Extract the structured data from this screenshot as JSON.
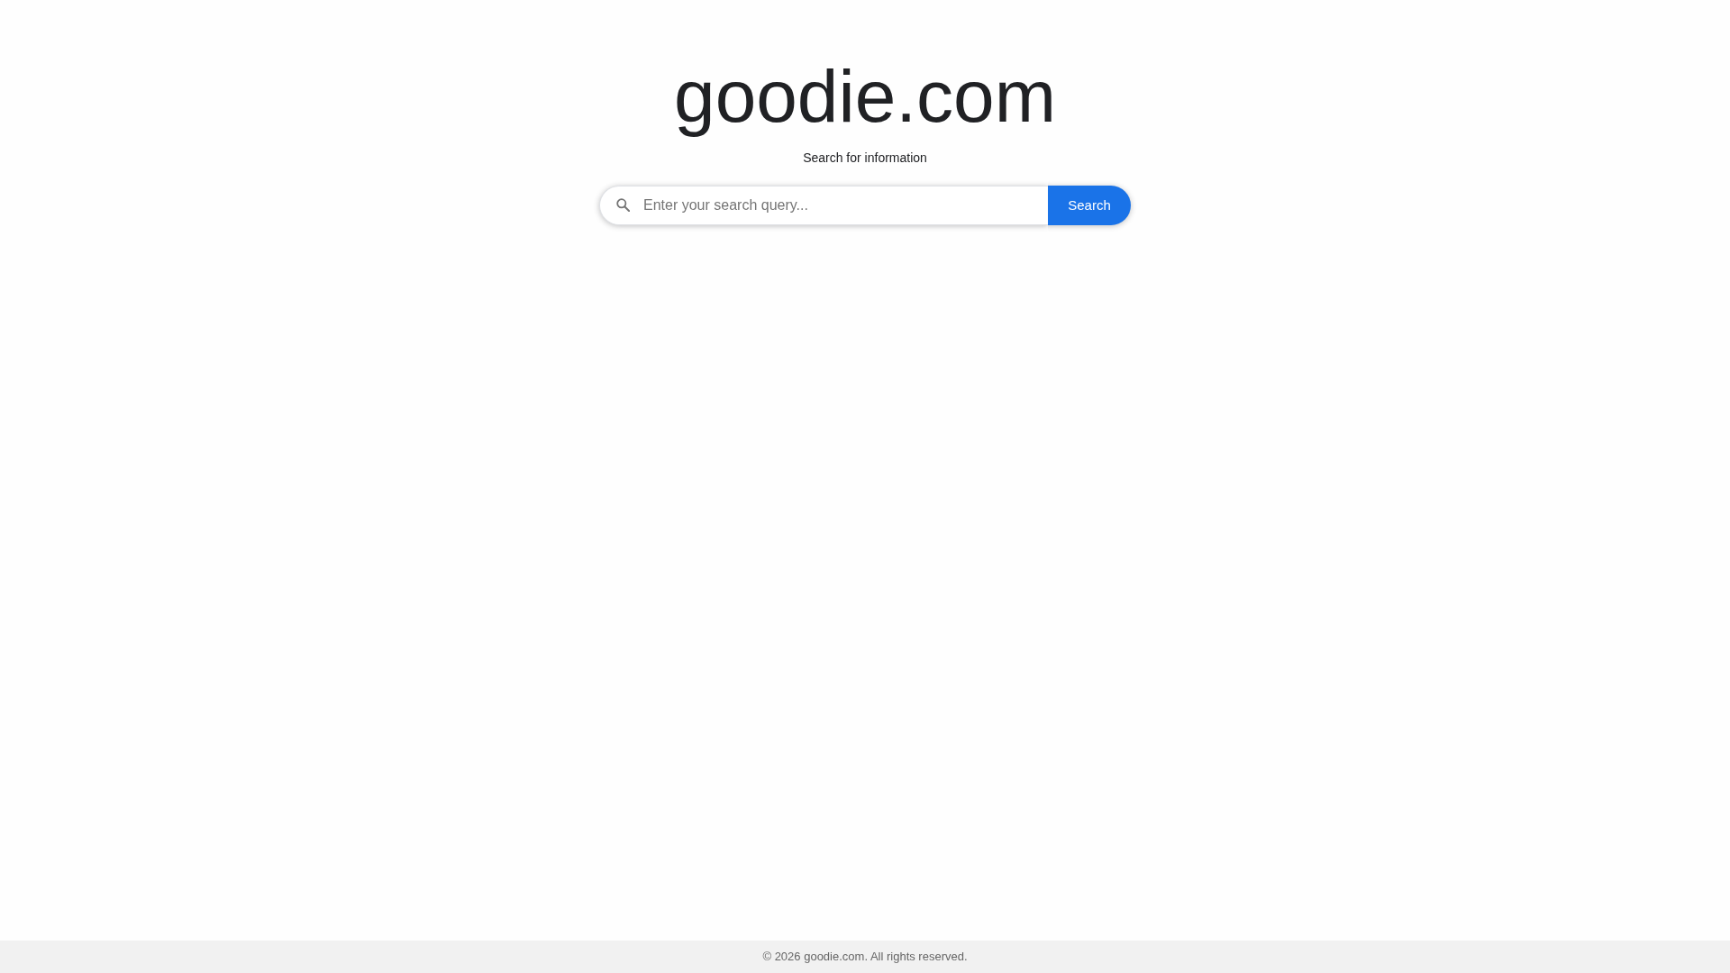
{
  "header": {
    "logo": "goodie.com",
    "tagline": "Search for information"
  },
  "search": {
    "placeholder": "Enter your search query...",
    "button": "Search"
  },
  "footer": {
    "text": "© 2026 goodie.com. All rights reserved."
  }
}
